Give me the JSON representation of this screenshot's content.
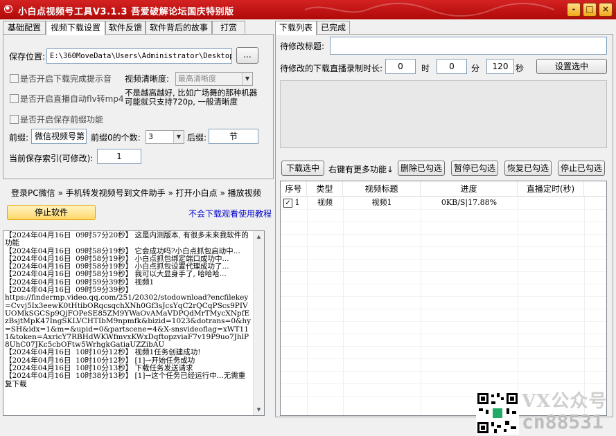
{
  "window": {
    "title": "小白点视频号工具V3.1.3 吾爱破解论坛国庆特别版",
    "controls": {
      "minimize": "-",
      "maximize": "□",
      "close": "×"
    }
  },
  "left_tabs": [
    "基础配置",
    "视频下载设置",
    "软件反馈",
    "软件背后的故事",
    "打赏"
  ],
  "settings": {
    "save_location_label": "保存位置:",
    "save_location_value": "E:\\360MoveData\\Users\\Administrator\\Desktop",
    "browse_button": "...",
    "notify_on_complete": "是否开启下载完成提示音",
    "clarity_label": "视频清晰度:",
    "clarity_value": "最高清晰度",
    "auto_flv_to_mp4": "是否开启直播自动flv转mp4",
    "clarity_note": "不是越高越好, 比如广场舞的那种机器可能就只支持720p, 一般清晰度",
    "save_suffix": "是否开启保存前缀功能",
    "prefix_label": "前缀:",
    "prefix_value": "微信视频号第",
    "leading_zeros_label": "前缀0的个数:",
    "leading_zeros_value": "3",
    "suffix_label": "后缀:",
    "suffix_value": "节",
    "index_label": "当前保存索引(可修改):",
    "index_value": "1"
  },
  "quick_links": {
    "login": "登录PC微信",
    "forward": "手机转发视频号到文件助手",
    "open": "打开小白点",
    "play": "播放视频",
    "sep": "»"
  },
  "stop_button": "停止软件",
  "help_link": "不会下载观看使用教程",
  "log_lines": [
    "【2024年04月16日  09时57分20秒】 这是内测版本, 有很多未来我软件的功能",
    "【2024年04月16日  09时58分19秒】 它会成功吗?小白点抓包启动中...",
    "【2024年04月16日  09时58分19秒】 小白点抓包绑定端口成功中...",
    "【2024年04月16日  09时58分19秒】 小白点抓包设置代理成功了...",
    "【2024年04月16日  09时58分19秒】 我可以大显身手了, 哈哈哈...",
    "【2024年04月16日  09时59分39秒】 视频1",
    "【2024年04月16日  09时59分39秒】",
    "https://findermp.video.qq.com/251/20302/stodownload?encfilekey=Cvvj5Ix3eewK0tHtibORqcsqchXNh0Gf3sJcsYqC2rQCqPScs9PIVUOMkSGCSp9QjFOPeSE85ZM9YWaOvAMaVDPQdMrTMycXNpfEzBsjtMpK47IngSKLVCHTIbM9npmfk&bizid=1023&dotrans=0&hy=SH&idx=1&m=&upid=0&partscene=4&X-snsvideoflag=xWT111&token=AxricY7RBHdWKWfmvxKWxDqftopzviaF7v19P9uo7JhlP8UhC07JKc5cbOFtw5WrhgkGatiaUZZibAU",
    "【2024年04月16日  10时10分12秒】 视频1任务创建成功!",
    "【2024年04月16日  10时10分12秒】 [1]→开始任务成功",
    "【2024年04月16日  10时10分13秒】 下载任务发送请求",
    "【2024年04月16日  10时38分13秒】 [1]→这个任务已经运行中...无需重复下载"
  ],
  "right_tabs": [
    "下载列表",
    "已完成"
  ],
  "download_form": {
    "title_label": "待修改标题:",
    "title_value": "",
    "duration_label": "待修改的下载直播录制时长:",
    "hours_value": "0",
    "hours_unit": "时",
    "minutes_value": "0",
    "minutes_unit": "分",
    "seconds_value": "120",
    "seconds_unit": "秒",
    "apply_button": "设置选中"
  },
  "actions": {
    "download_selected": "下载选中",
    "more_hint": "右键有更多功能↓",
    "delete_checked": "删除已勾选",
    "pause_checked": "暂停已勾选",
    "resume_checked": "恢复已勾选",
    "stop_checked": "停止已勾选"
  },
  "table": {
    "columns": [
      "序号",
      "类型",
      "视频标题",
      "进度",
      "直播定时(秒)"
    ],
    "rows": [
      {
        "checked": true,
        "index": "1",
        "type": "视频",
        "title": "视频1",
        "progress": "0KB/S|17.88%",
        "schedule": ""
      }
    ]
  },
  "watermark_text": {
    "line1": "VX公众号",
    "line2": "cn88531"
  }
}
